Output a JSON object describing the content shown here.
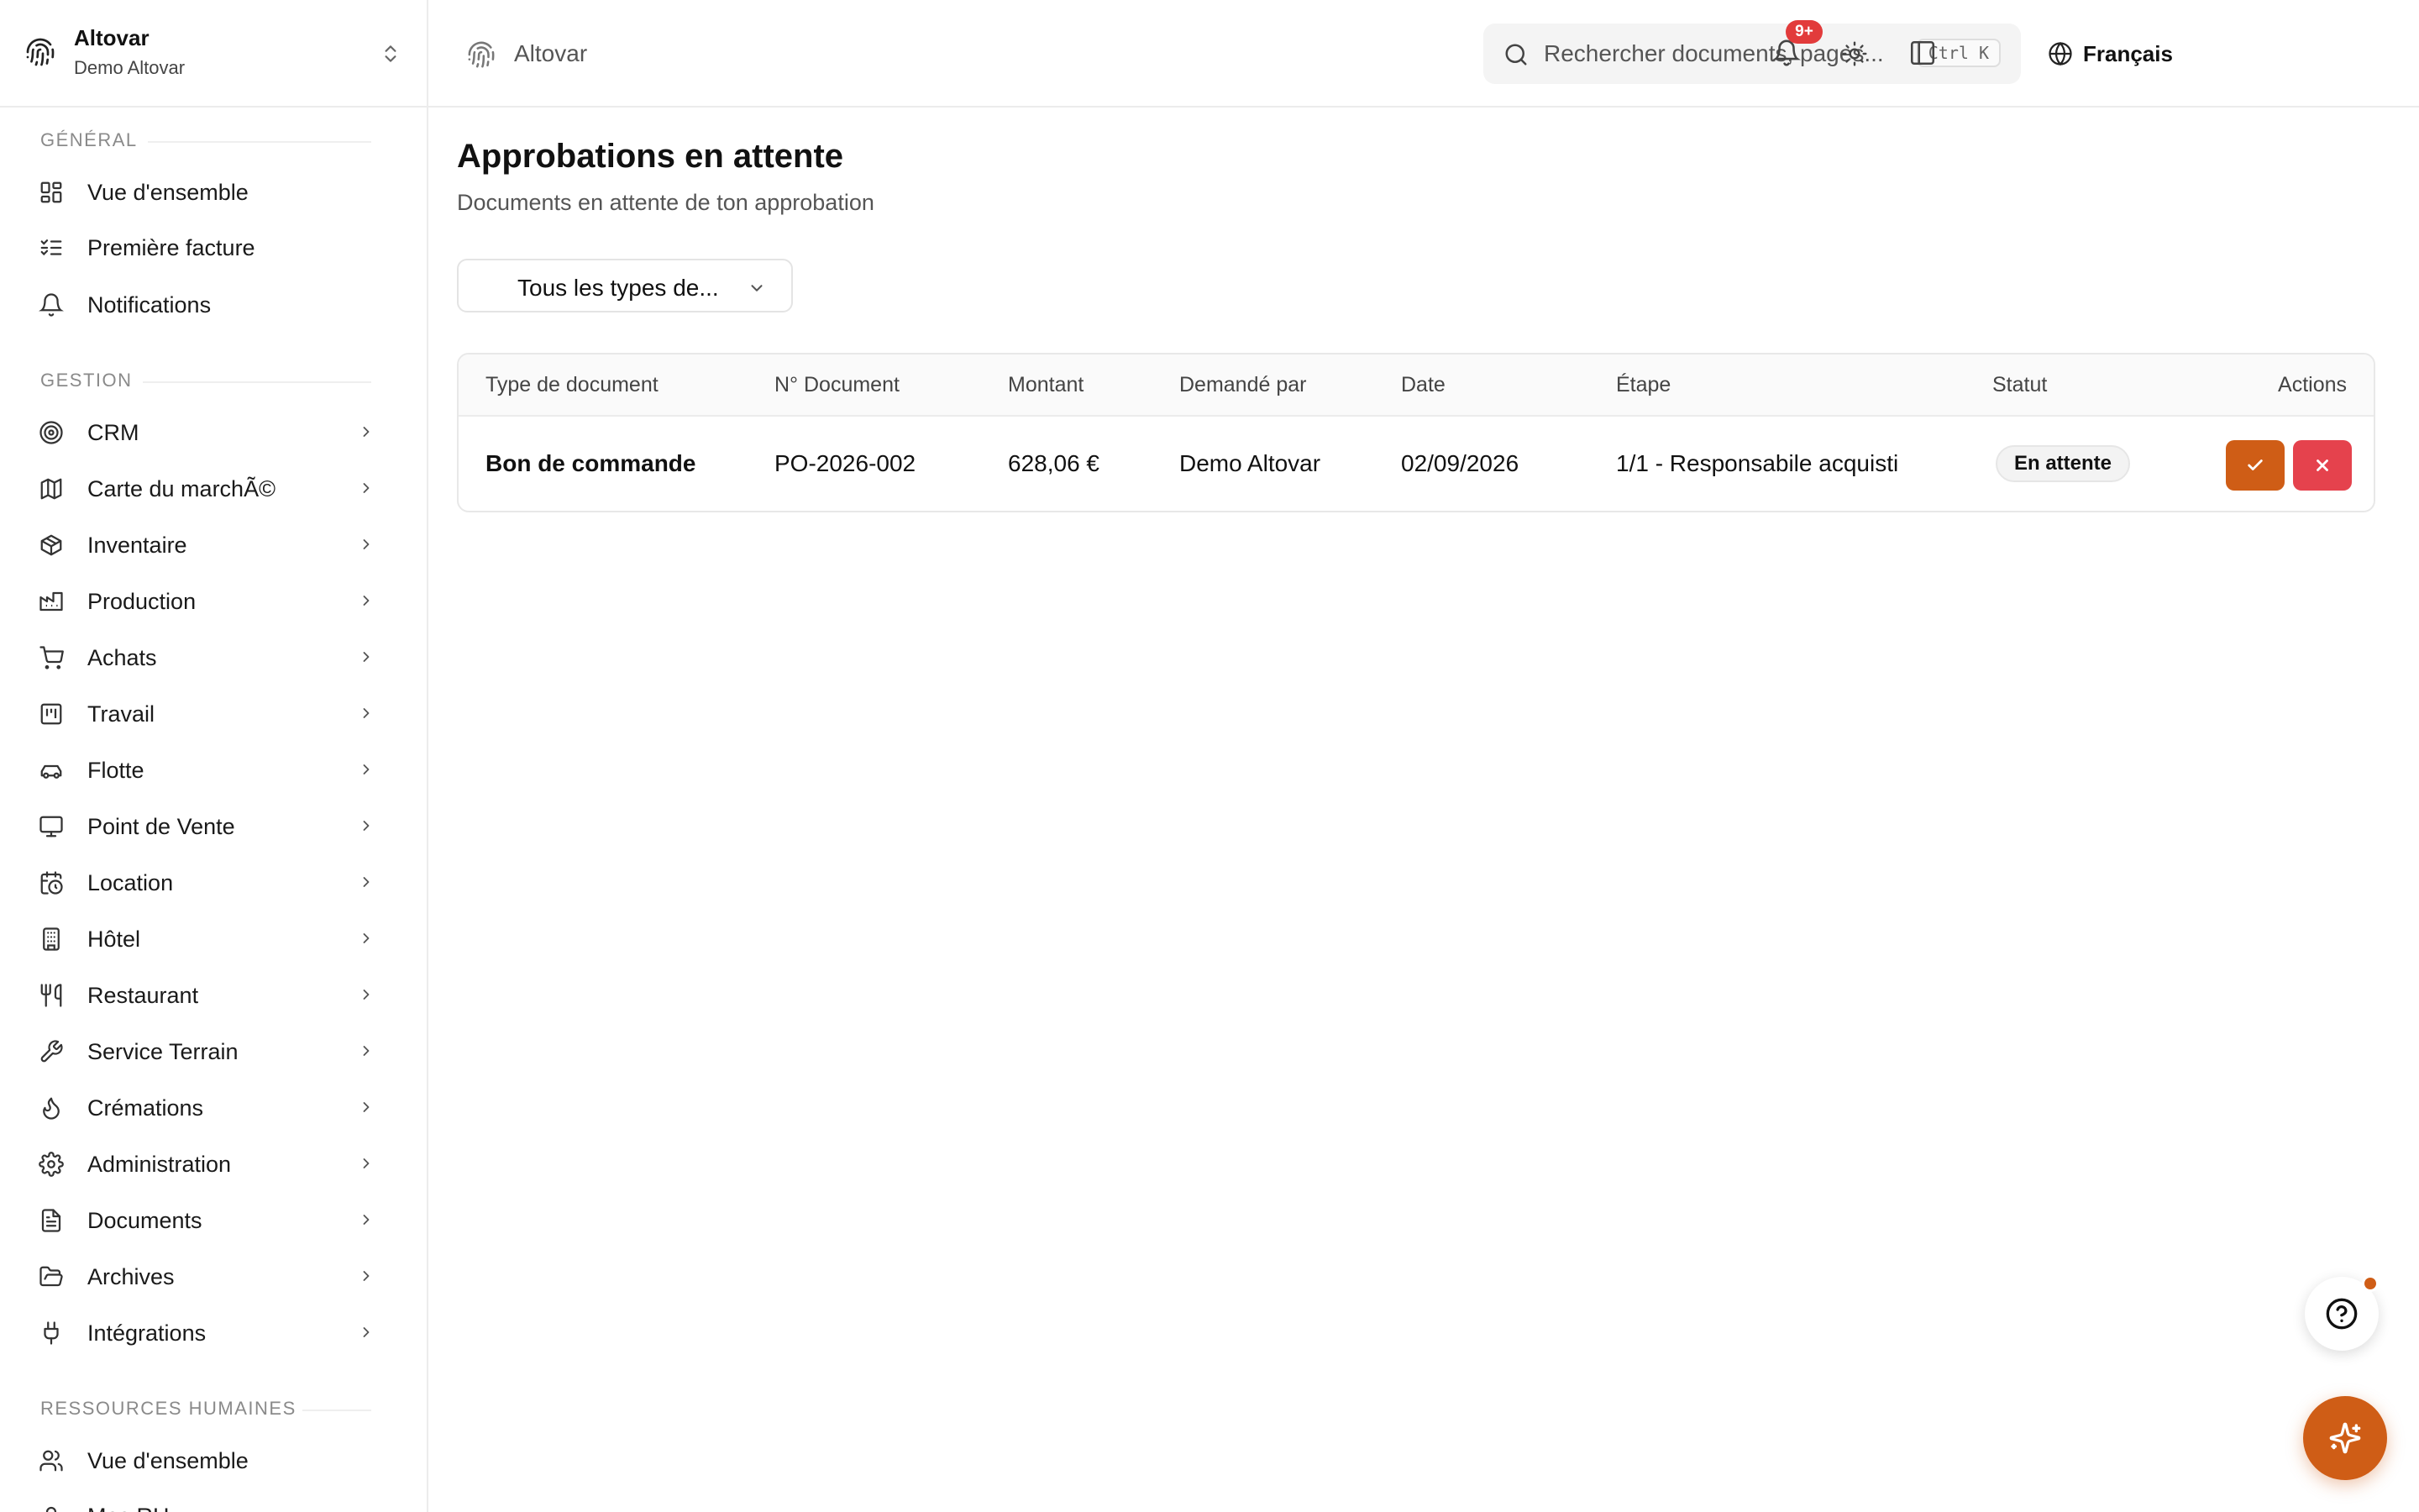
{
  "org": {
    "name": "Altovar",
    "subtitle": "Demo Altovar"
  },
  "sidebar": {
    "sections": [
      {
        "label": "Général",
        "items": [
          {
            "label": "Vue d'ensemble",
            "icon": "dashboard-icon"
          },
          {
            "label": "Première facture",
            "icon": "checklist-icon"
          },
          {
            "label": "Notifications",
            "icon": "bell-icon"
          }
        ]
      },
      {
        "label": "Gestion",
        "items": [
          {
            "label": "CRM",
            "icon": "target-icon"
          },
          {
            "label": "Carte du marchÃ©",
            "icon": "map-icon"
          },
          {
            "label": "Inventaire",
            "icon": "package-icon"
          },
          {
            "label": "Production",
            "icon": "factory-icon"
          },
          {
            "label": "Achats",
            "icon": "cart-icon"
          },
          {
            "label": "Travail",
            "icon": "kanban-icon"
          },
          {
            "label": "Flotte",
            "icon": "car-icon"
          },
          {
            "label": "Point de Vente",
            "icon": "monitor-icon"
          },
          {
            "label": "Location",
            "icon": "calendar-clock-icon"
          },
          {
            "label": "Hôtel",
            "icon": "building-icon"
          },
          {
            "label": "Restaurant",
            "icon": "utensils-icon"
          },
          {
            "label": "Service Terrain",
            "icon": "wrench-icon"
          },
          {
            "label": "Crémations",
            "icon": "flame-icon"
          },
          {
            "label": "Administration",
            "icon": "gear-icon"
          },
          {
            "label": "Documents",
            "icon": "file-icon"
          },
          {
            "label": "Archives",
            "icon": "folder-open-icon"
          },
          {
            "label": "Intégrations",
            "icon": "plug-icon"
          }
        ]
      },
      {
        "label": "Ressources humaines",
        "items": [
          {
            "label": "Vue d'ensemble",
            "icon": "users-icon"
          },
          {
            "label": "Mes RH",
            "icon": "user-icon"
          }
        ]
      }
    ]
  },
  "header": {
    "breadcrumb": "Altovar",
    "search_placeholder": "Rechercher documents, pages...",
    "search_shortcut": "Ctrl K",
    "language": "Français",
    "notification_count": "9+"
  },
  "main": {
    "title": "Approbations en attente",
    "subtitle": "Documents en attente de ton approbation",
    "filter_value": "Tous les types de...",
    "table": {
      "columns": [
        "Type de document",
        "N° Document",
        "Montant",
        "Demandé par",
        "Date",
        "Étape",
        "Statut",
        "Actions"
      ],
      "rows": [
        {
          "type": "Bon de commande",
          "number": "PO-2026-002",
          "amount": "628,06 €",
          "requested_by": "Demo Altovar",
          "date": "02/09/2026",
          "step": "1/1 - Responsabile acquisti",
          "status": "En attente"
        }
      ]
    }
  },
  "colors": {
    "accent": "#cf5d16",
    "danger": "#e5424d",
    "badge": "#e23b3b"
  }
}
